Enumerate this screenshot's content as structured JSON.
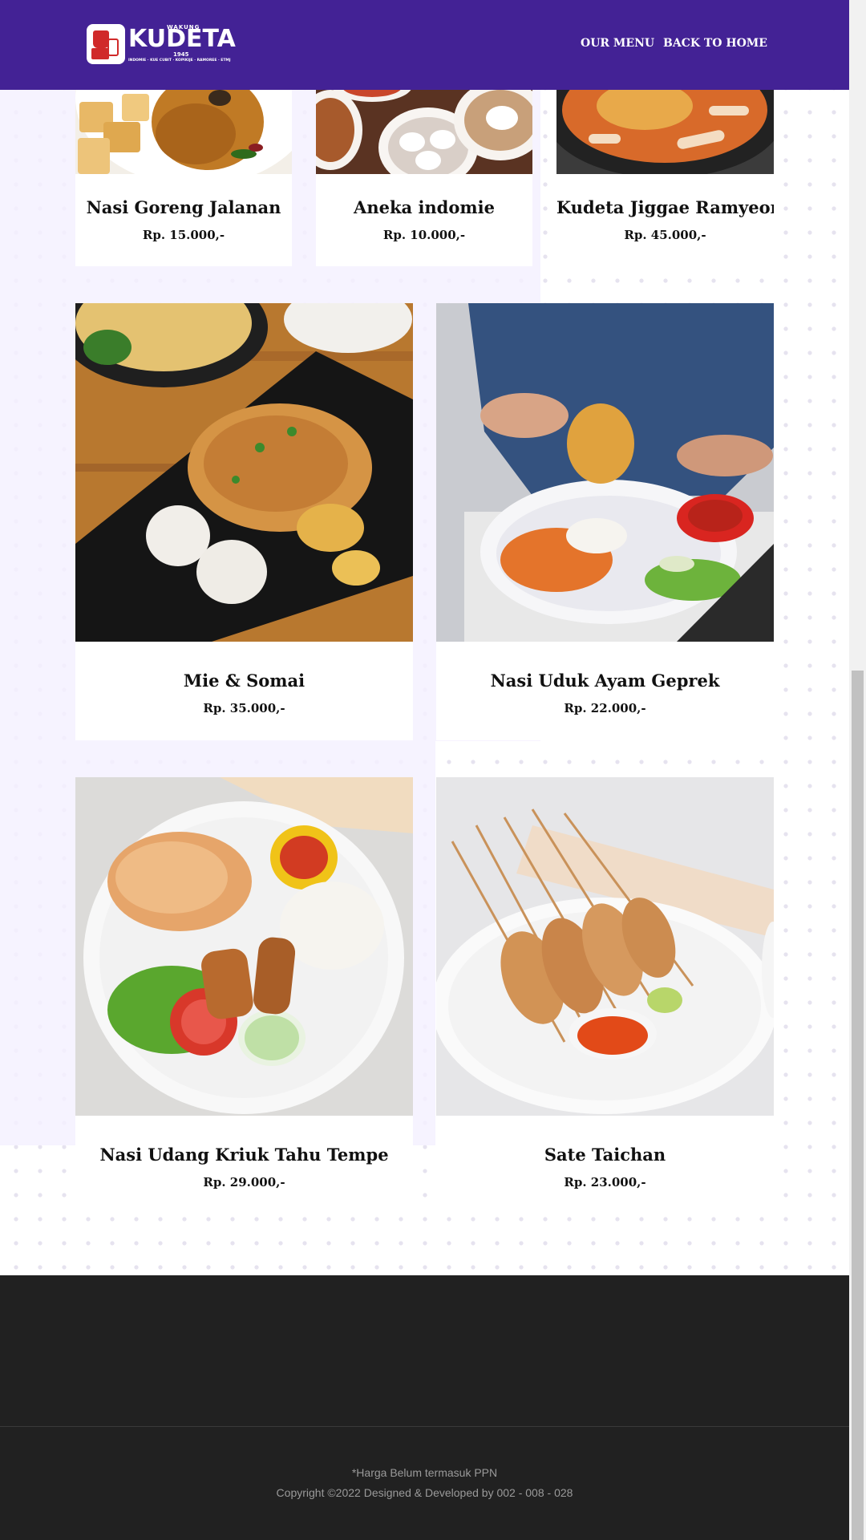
{
  "brand": {
    "small_text": "WAKUNG",
    "name": "KUDETA",
    "year": "1945",
    "tagline": "INDOMIE · KUE CUBIT · KOPIKIJE · RAMOREE · ETMJ"
  },
  "nav": {
    "menu_label": "OUR MENU",
    "home_label": "BACK TO HOME"
  },
  "menu_items": [
    {
      "name": "Nasi Goreng Jalanan",
      "price": "Rp. 15.000,-"
    },
    {
      "name": "Aneka indomie",
      "price": "Rp. 10.000,-"
    },
    {
      "name": "Kudeta Jiggae Ramyeon",
      "price": "Rp. 45.000,-"
    },
    {
      "name": "Mie & Somai",
      "price": "Rp. 35.000,-"
    },
    {
      "name": "Nasi Uduk Ayam Geprek",
      "price": "Rp. 22.000,-"
    },
    {
      "name": "Nasi Udang Kriuk Tahu Tempe",
      "price": "Rp. 29.000,-"
    },
    {
      "name": "Sate Taichan",
      "price": "Rp. 23.000,-"
    }
  ],
  "footer": {
    "note": "*Harga Belum termasuk PPN",
    "copyright": "Copyright ©2022 Designed & Developed by 002 - 008 - 028"
  },
  "colors": {
    "header": "#432295",
    "footer": "#212121"
  }
}
